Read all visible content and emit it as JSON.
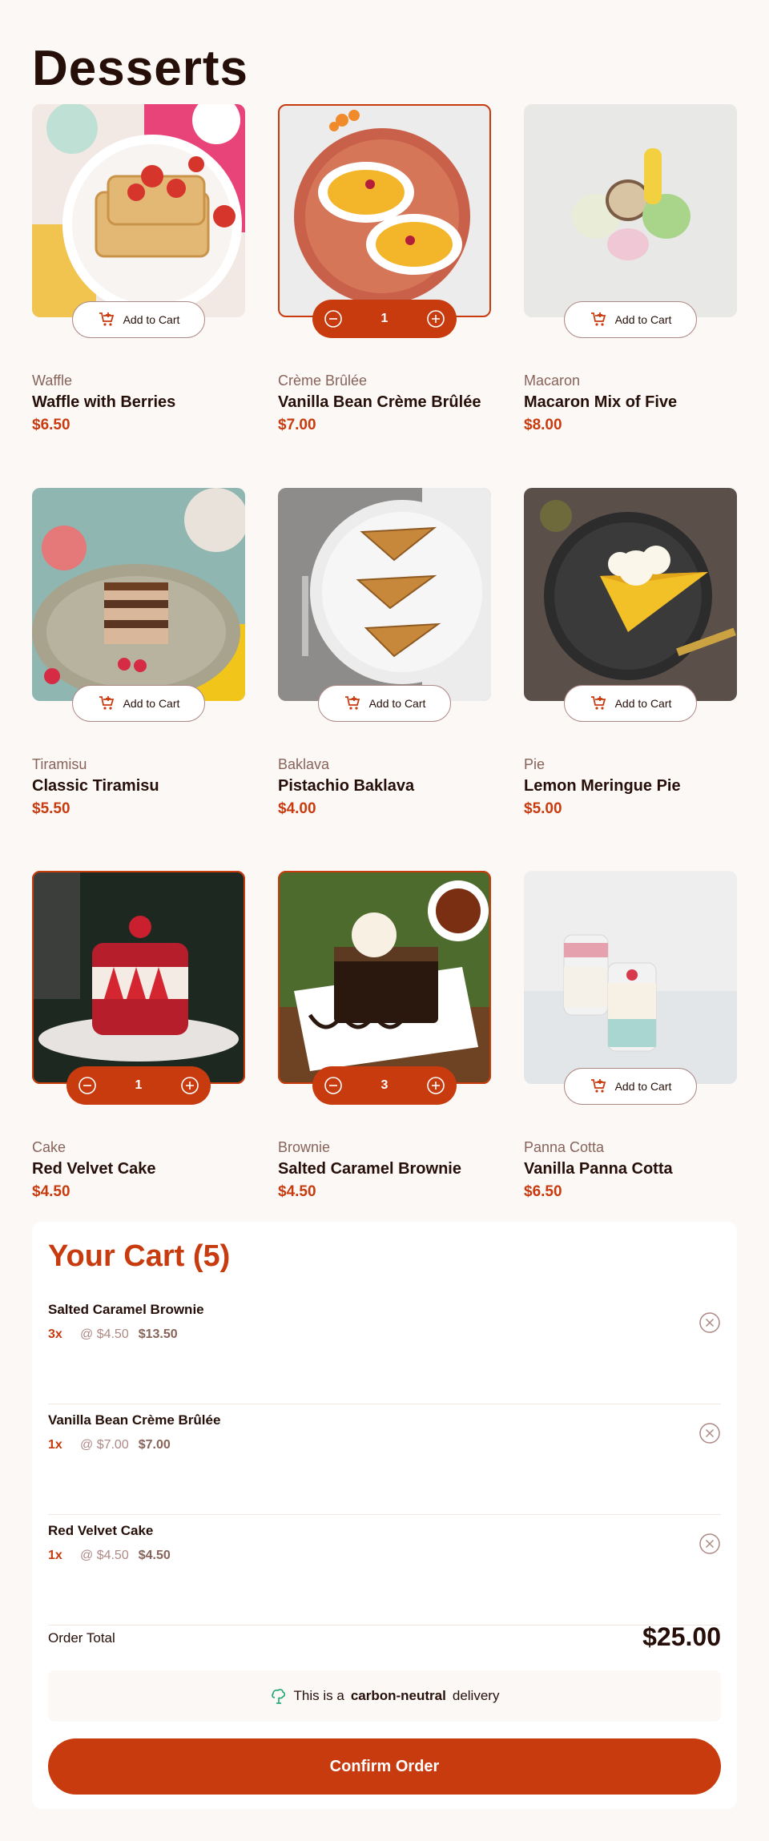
{
  "page": {
    "title": "Desserts"
  },
  "colors": {
    "accent": "#c73b0f",
    "text": "#260f08",
    "muted": "#87635a",
    "bg": "#fcf8f6",
    "carbon": "#1ea575"
  },
  "buttons": {
    "add_to_cart": "Add to Cart",
    "confirm": "Confirm Order"
  },
  "products": [
    {
      "category": "Waffle",
      "name": "Waffle with Berries",
      "price": "$6.50",
      "in_cart": false,
      "qty": ""
    },
    {
      "category": "Crème Brûlée",
      "name": "Vanilla Bean Crème Brûlée",
      "price": "$7.00",
      "in_cart": true,
      "qty": "1"
    },
    {
      "category": "Macaron",
      "name": "Macaron Mix of Five",
      "price": "$8.00",
      "in_cart": false,
      "qty": ""
    },
    {
      "category": "Tiramisu",
      "name": "Classic Tiramisu",
      "price": "$5.50",
      "in_cart": false,
      "qty": ""
    },
    {
      "category": "Baklava",
      "name": "Pistachio Baklava",
      "price": "$4.00",
      "in_cart": false,
      "qty": ""
    },
    {
      "category": "Pie",
      "name": "Lemon Meringue Pie",
      "price": "$5.00",
      "in_cart": false,
      "qty": ""
    },
    {
      "category": "Cake",
      "name": "Red Velvet Cake",
      "price": "$4.50",
      "in_cart": true,
      "qty": "1"
    },
    {
      "category": "Brownie",
      "name": "Salted Caramel Brownie",
      "price": "$4.50",
      "in_cart": true,
      "qty": "3"
    },
    {
      "category": "Panna Cotta",
      "name": "Vanilla Panna Cotta",
      "price": "$6.50",
      "in_cart": false,
      "qty": ""
    }
  ],
  "cart": {
    "title": "Your Cart (5)",
    "items": [
      {
        "name": "Salted Caramel Brownie",
        "qty": "3x",
        "unit": "@ $4.50",
        "total": "$13.50"
      },
      {
        "name": "Vanilla Bean Crème Brûlée",
        "qty": "1x",
        "unit": "@ $7.00",
        "total": "$7.00"
      },
      {
        "name": "Red Velvet Cake",
        "qty": "1x",
        "unit": "@ $4.50",
        "total": "$4.50"
      }
    ],
    "order_total_label": "Order Total",
    "order_total": "$25.00",
    "carbon_prefix": "This is a",
    "carbon_bold": "carbon-neutral",
    "carbon_suffix": "delivery"
  }
}
